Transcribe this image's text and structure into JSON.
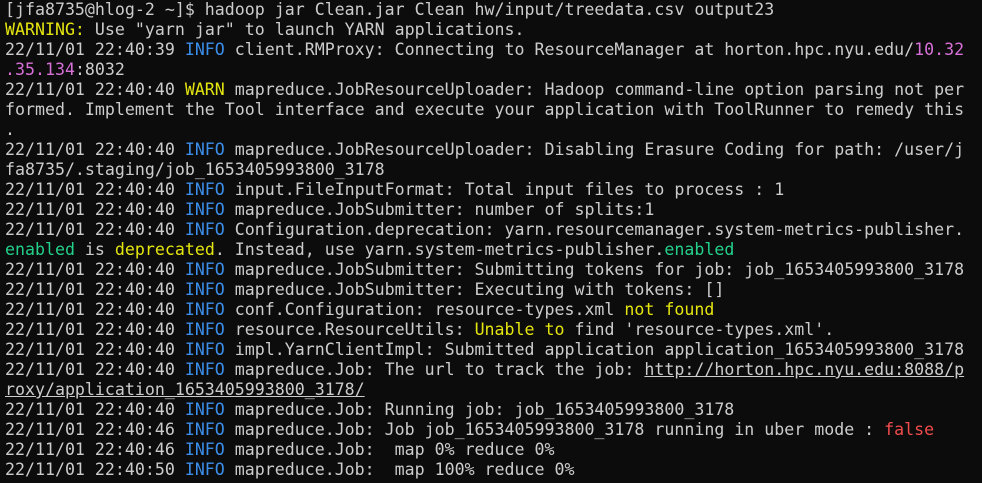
{
  "colors": {
    "background": "#0c0c0c",
    "default": "#cccccc",
    "yellow": "#e5e510",
    "blue": "#3b8eea",
    "magenta": "#d670d6",
    "green": "#23d18b",
    "red": "#f14c4c"
  },
  "terminal": {
    "lines": [
      {
        "segments": [
          {
            "text": "[jfa8735@hlog-2 ~]$ hadoop jar Clean.jar Clean hw/input/treedata.csv output23",
            "color": "default"
          }
        ]
      },
      {
        "segments": [
          {
            "text": "WARNING:",
            "color": "yellow"
          },
          {
            "text": " Use \"yarn jar\" to launch YARN applications.",
            "color": "default"
          }
        ]
      },
      {
        "segments": [
          {
            "text": "22/11/01 22:40:39 ",
            "color": "default"
          },
          {
            "text": "INFO",
            "color": "blue"
          },
          {
            "text": " client.RMProxy: Connecting to ResourceManager at horton.hpc.nyu.edu/",
            "color": "default"
          },
          {
            "text": "10.32",
            "color": "magenta"
          }
        ]
      },
      {
        "segments": [
          {
            "text": ".35.134",
            "color": "magenta"
          },
          {
            "text": ":8032",
            "color": "default"
          }
        ]
      },
      {
        "segments": [
          {
            "text": "22/11/01 22:40:40 ",
            "color": "default"
          },
          {
            "text": "WARN",
            "color": "yellow"
          },
          {
            "text": " mapreduce.JobResourceUploader: Hadoop command-line option parsing not per",
            "color": "default"
          }
        ]
      },
      {
        "segments": [
          {
            "text": "formed. Implement the Tool interface and execute your application with ToolRunner to remedy this",
            "color": "default"
          }
        ]
      },
      {
        "segments": [
          {
            "text": ".",
            "color": "default"
          }
        ]
      },
      {
        "segments": [
          {
            "text": "22/11/01 22:40:40 ",
            "color": "default"
          },
          {
            "text": "INFO",
            "color": "blue"
          },
          {
            "text": " mapreduce.JobResourceUploader: Disabling Erasure Coding for path: /user/j",
            "color": "default"
          }
        ]
      },
      {
        "segments": [
          {
            "text": "fa8735/.staging/job_1653405993800_3178",
            "color": "default"
          }
        ]
      },
      {
        "segments": [
          {
            "text": "22/11/01 22:40:40 ",
            "color": "default"
          },
          {
            "text": "INFO",
            "color": "blue"
          },
          {
            "text": " input.FileInputFormat: Total input files to process : 1",
            "color": "default"
          }
        ]
      },
      {
        "segments": [
          {
            "text": "22/11/01 22:40:40 ",
            "color": "default"
          },
          {
            "text": "INFO",
            "color": "blue"
          },
          {
            "text": " mapreduce.JobSubmitter: number of splits:1",
            "color": "default"
          }
        ]
      },
      {
        "segments": [
          {
            "text": "22/11/01 22:40:40 ",
            "color": "default"
          },
          {
            "text": "INFO",
            "color": "blue"
          },
          {
            "text": " Configuration.deprecation: yarn.resourcemanager.system-metrics-publisher.",
            "color": "default"
          }
        ]
      },
      {
        "segments": [
          {
            "text": "enabled",
            "color": "green"
          },
          {
            "text": " is ",
            "color": "default"
          },
          {
            "text": "deprecated",
            "color": "yellow"
          },
          {
            "text": ". Instead, use yarn.system-metrics-publisher.",
            "color": "default"
          },
          {
            "text": "enabled",
            "color": "green"
          }
        ]
      },
      {
        "segments": [
          {
            "text": "22/11/01 22:40:40 ",
            "color": "default"
          },
          {
            "text": "INFO",
            "color": "blue"
          },
          {
            "text": " mapreduce.JobSubmitter: Submitting tokens for job: job_1653405993800_3178",
            "color": "default"
          }
        ]
      },
      {
        "segments": [
          {
            "text": "22/11/01 22:40:40 ",
            "color": "default"
          },
          {
            "text": "INFO",
            "color": "blue"
          },
          {
            "text": " mapreduce.JobSubmitter: Executing with tokens: []",
            "color": "default"
          }
        ]
      },
      {
        "segments": [
          {
            "text": "22/11/01 22:40:40 ",
            "color": "default"
          },
          {
            "text": "INFO",
            "color": "blue"
          },
          {
            "text": " conf.Configuration: resource-types.xml ",
            "color": "default"
          },
          {
            "text": "not found",
            "color": "yellow"
          }
        ]
      },
      {
        "segments": [
          {
            "text": "22/11/01 22:40:40 ",
            "color": "default"
          },
          {
            "text": "INFO",
            "color": "blue"
          },
          {
            "text": " resource.ResourceUtils: ",
            "color": "default"
          },
          {
            "text": "Unable to",
            "color": "yellow"
          },
          {
            "text": " find 'resource-types.xml'.",
            "color": "default"
          }
        ]
      },
      {
        "segments": [
          {
            "text": "22/11/01 22:40:40 ",
            "color": "default"
          },
          {
            "text": "INFO",
            "color": "blue"
          },
          {
            "text": " impl.YarnClientImpl: Submitted application application_1653405993800_3178",
            "color": "default"
          }
        ]
      },
      {
        "segments": [
          {
            "text": "22/11/01 22:40:40 ",
            "color": "default"
          },
          {
            "text": "INFO",
            "color": "blue"
          },
          {
            "text": " mapreduce.Job: The url to track the job: ",
            "color": "default"
          },
          {
            "text": "http://horton.hpc.nyu.edu:8088/p",
            "color": "default",
            "link": true
          }
        ]
      },
      {
        "segments": [
          {
            "text": "roxy/application_1653405993800_3178/",
            "color": "default",
            "link": true
          }
        ]
      },
      {
        "segments": [
          {
            "text": "22/11/01 22:40:40 ",
            "color": "default"
          },
          {
            "text": "INFO",
            "color": "blue"
          },
          {
            "text": " mapreduce.Job: Running job: job_1653405993800_3178",
            "color": "default"
          }
        ]
      },
      {
        "segments": [
          {
            "text": "22/11/01 22:40:46 ",
            "color": "default"
          },
          {
            "text": "INFO",
            "color": "blue"
          },
          {
            "text": " mapreduce.Job: Job job_1653405993800_3178 running in uber mode : ",
            "color": "default"
          },
          {
            "text": "false",
            "color": "red"
          }
        ]
      },
      {
        "segments": [
          {
            "text": "22/11/01 22:40:46 ",
            "color": "default"
          },
          {
            "text": "INFO",
            "color": "blue"
          },
          {
            "text": " mapreduce.Job:  map 0% reduce 0%",
            "color": "default"
          }
        ]
      },
      {
        "segments": [
          {
            "text": "22/11/01 22:40:50 ",
            "color": "default"
          },
          {
            "text": "INFO",
            "color": "blue"
          },
          {
            "text": " mapreduce.Job:  map 100% reduce 0%",
            "color": "default"
          }
        ]
      }
    ]
  }
}
